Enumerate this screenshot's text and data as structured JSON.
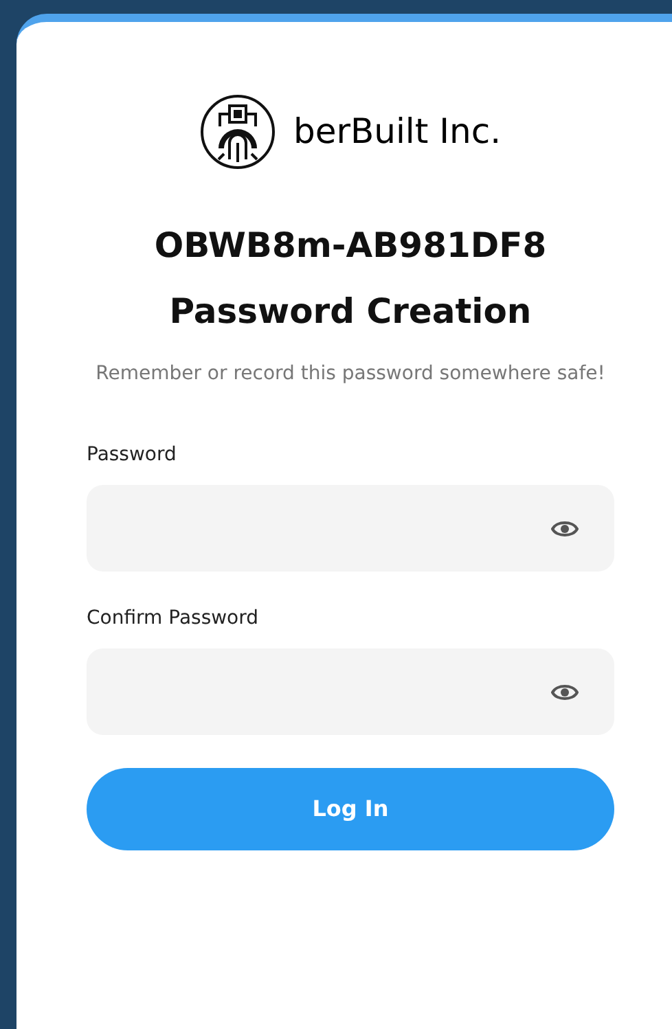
{
  "brand": {
    "name": "berBuilt Inc."
  },
  "title": "OBWB8m-AB981DF8",
  "subtitle": "Password Creation",
  "note": "Remember or record this password somewhere safe!",
  "fields": [
    {
      "label": "Password"
    },
    {
      "label": "Confirm Password"
    }
  ],
  "button": "Log In"
}
